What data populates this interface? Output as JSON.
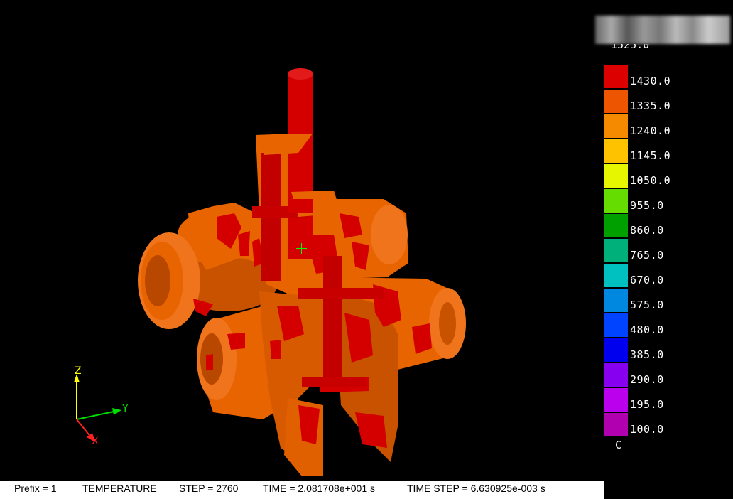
{
  "legend": {
    "top_value_partial": "1525.0",
    "unit": "C",
    "entries": [
      {
        "value": "1430.0",
        "color": "#dd0000"
      },
      {
        "value": "1335.0",
        "color": "#ee5500"
      },
      {
        "value": "1240.0",
        "color": "#f58a00"
      },
      {
        "value": "1145.0",
        "color": "#ffc200"
      },
      {
        "value": "1050.0",
        "color": "#e6f500"
      },
      {
        "value": "955.0",
        "color": "#66dd00"
      },
      {
        "value": "860.0",
        "color": "#00a000"
      },
      {
        "value": "765.0",
        "color": "#00b07a"
      },
      {
        "value": "670.0",
        "color": "#00c0c0"
      },
      {
        "value": "575.0",
        "color": "#0088e0"
      },
      {
        "value": "480.0",
        "color": "#0044ff"
      },
      {
        "value": "385.0",
        "color": "#0000ee"
      },
      {
        "value": "290.0",
        "color": "#8800f0"
      },
      {
        "value": "195.0",
        "color": "#bb00ee"
      },
      {
        "value": "100.0",
        "color": "#b000b0"
      }
    ]
  },
  "axes": {
    "x": "X",
    "y": "Y",
    "z": "Z"
  },
  "status": {
    "prefix": "Prefix = 1",
    "variable": "TEMPERATURE",
    "step": "STEP = 2760",
    "time": "TIME = 2.081708e+001 s",
    "time_step": "TIME STEP = 6.630925e-003 s"
  },
  "colors": {
    "hot": "#d40000",
    "body": "#e86400",
    "body_shade": "#b84800",
    "body_light": "#f7802a",
    "background": "#000000"
  }
}
